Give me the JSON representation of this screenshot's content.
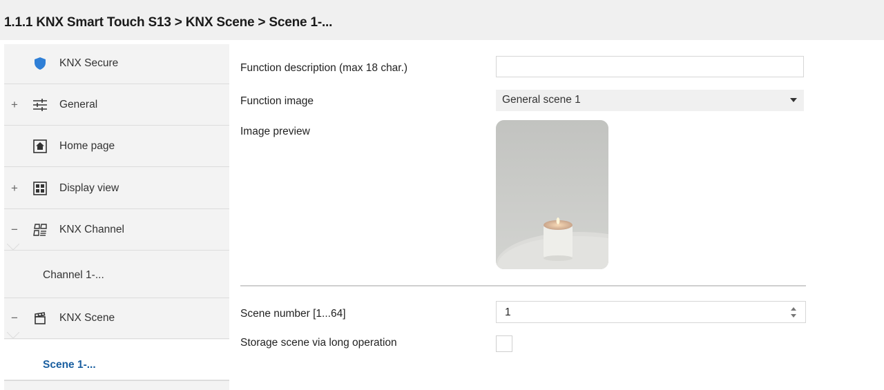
{
  "header": {
    "breadcrumb": "1.1.1 KNX Smart Touch S13 > KNX Scene > Scene 1-..."
  },
  "sidebar": {
    "items": [
      {
        "label": "KNX Secure",
        "icon": "shield-icon",
        "expander": ""
      },
      {
        "label": "General",
        "icon": "sliders-icon",
        "expander": "+"
      },
      {
        "label": "Home page",
        "icon": "home-icon",
        "expander": ""
      },
      {
        "label": "Display view",
        "icon": "grid-view-icon",
        "expander": "+"
      },
      {
        "label": "KNX Channel",
        "icon": "channel-icon",
        "expander": "−"
      },
      {
        "label": "Channel 1-...",
        "icon": "",
        "expander": ""
      },
      {
        "label": "KNX Scene",
        "icon": "clapperboard-icon",
        "expander": "−"
      },
      {
        "label": "Scene 1-...",
        "icon": "",
        "expander": ""
      }
    ]
  },
  "form": {
    "function_description": {
      "label": "Function description (max 18 char.)",
      "value": ""
    },
    "function_image": {
      "label": "Function image",
      "value": "General scene 1"
    },
    "image_preview": {
      "label": "Image preview"
    },
    "scene_number": {
      "label": "Scene number [1...64]",
      "value": "1"
    },
    "storage_scene": {
      "label": "Storage scene via long operation",
      "checked": false
    }
  },
  "colors": {
    "accent": "#1a5fa0",
    "shield": "#2f7fd6",
    "sidebar_bg": "#f3f3f3",
    "header_bg": "#f0f0f0"
  }
}
